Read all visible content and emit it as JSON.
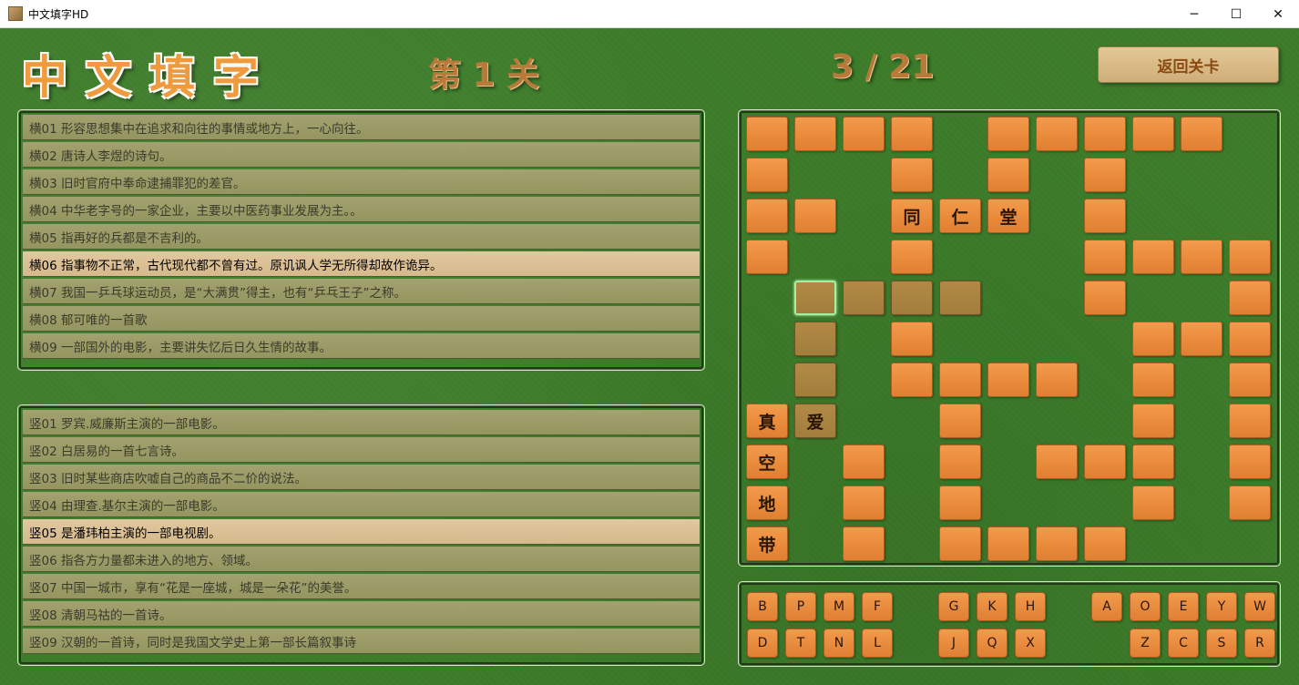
{
  "window": {
    "title": "中文填字HD",
    "minimize": "─",
    "maximize": "☐",
    "close": "✕"
  },
  "header": {
    "logo": "中文填字",
    "level": "第 1 关",
    "progress": "3 / 21",
    "back_button": "返回关卡"
  },
  "clues_across": [
    {
      "text": "横01 形容思想集中在追求和向往的事情或地方上，一心向往。",
      "active": false
    },
    {
      "text": "横02 唐诗人李煜的诗句。",
      "active": false
    },
    {
      "text": "横03 旧时官府中奉命逮捕罪犯的差官。",
      "active": false
    },
    {
      "text": "横04 中华老字号的一家企业，主要以中医药事业发展为主。。",
      "active": false
    },
    {
      "text": "横05 指再好的兵都是不吉利的。",
      "active": false
    },
    {
      "text": "横06 指事物不正常，古代现代都不曾有过。原讥讽人学无所得却故作诡异。",
      "active": true
    },
    {
      "text": "横07 我国一乒乓球运动员，是“大满贯”得主，也有“乒乓王子”之称。",
      "active": false
    },
    {
      "text": "横08 郁可唯的一首歌",
      "active": false
    },
    {
      "text": "横09 一部国外的电影，主要讲失忆后日久生情的故事。",
      "active": false
    }
  ],
  "clues_down": [
    {
      "text": "竖01 罗宾.威廉斯主演的一部电影。",
      "active": false
    },
    {
      "text": "竖02 白居易的一首七言诗。",
      "active": false
    },
    {
      "text": "竖03 旧时某些商店吹嘘自己的商品不二价的说法。",
      "active": false
    },
    {
      "text": "竖04 由理查.基尔主演的一部电影。",
      "active": false
    },
    {
      "text": "竖05 是潘玮柏主演的一部电视剧。",
      "active": true
    },
    {
      "text": "竖06 指各方力量都未进入的地方、领域。",
      "active": false
    },
    {
      "text": "竖07 中国一城市，享有“花是一座城，城是一朵花”的美誉。",
      "active": false
    },
    {
      "text": "竖08 清朝马祜的一首诗。",
      "active": false
    },
    {
      "text": "竖09 汉朝的一首诗，同时是我国文学史上第一部长篇叙事诗",
      "active": false
    }
  ],
  "grid": {
    "rows": [
      [
        1,
        1,
        1,
        1,
        0,
        1,
        1,
        1,
        1,
        1,
        0
      ],
      [
        1,
        0,
        0,
        1,
        0,
        1,
        0,
        1,
        0,
        0,
        0
      ],
      [
        1,
        1,
        0,
        1,
        1,
        1,
        0,
        1,
        0,
        0,
        0
      ],
      [
        1,
        0,
        0,
        1,
        0,
        0,
        0,
        1,
        1,
        1,
        1
      ],
      [
        0,
        2,
        2,
        2,
        2,
        0,
        0,
        1,
        0,
        0,
        1
      ],
      [
        0,
        2,
        0,
        1,
        0,
        0,
        0,
        0,
        1,
        1,
        1
      ],
      [
        0,
        2,
        0,
        1,
        1,
        1,
        1,
        0,
        1,
        0,
        1
      ],
      [
        1,
        2,
        0,
        0,
        1,
        0,
        0,
        0,
        1,
        0,
        1
      ],
      [
        1,
        0,
        1,
        0,
        1,
        0,
        1,
        1,
        1,
        0,
        1
      ],
      [
        1,
        0,
        1,
        0,
        1,
        0,
        0,
        0,
        1,
        0,
        1
      ],
      [
        1,
        0,
        1,
        0,
        1,
        1,
        1,
        1,
        0,
        0,
        0
      ]
    ],
    "selected": [
      4,
      1
    ],
    "letters": [
      {
        "r": 2,
        "c": 3,
        "ch": "同"
      },
      {
        "r": 2,
        "c": 4,
        "ch": "仁"
      },
      {
        "r": 2,
        "c": 5,
        "ch": "堂"
      },
      {
        "r": 7,
        "c": 0,
        "ch": "真"
      },
      {
        "r": 7,
        "c": 1,
        "ch": "爱"
      },
      {
        "r": 8,
        "c": 0,
        "ch": "空"
      },
      {
        "r": 9,
        "c": 0,
        "ch": "地"
      },
      {
        "r": 10,
        "c": 0,
        "ch": "带"
      }
    ]
  },
  "keyboard": {
    "row1": [
      {
        "label": "B",
        "col": 0
      },
      {
        "label": "P",
        "col": 1
      },
      {
        "label": "M",
        "col": 2
      },
      {
        "label": "F",
        "col": 3
      },
      {
        "label": "G",
        "col": 5
      },
      {
        "label": "K",
        "col": 6
      },
      {
        "label": "H",
        "col": 7
      },
      {
        "label": "A",
        "col": 9
      },
      {
        "label": "O",
        "col": 10
      },
      {
        "label": "E",
        "col": 11
      },
      {
        "label": "Y",
        "col": 12
      },
      {
        "label": "W",
        "col": 13
      }
    ],
    "row2": [
      {
        "label": "D",
        "col": 0
      },
      {
        "label": "T",
        "col": 1
      },
      {
        "label": "N",
        "col": 2
      },
      {
        "label": "L",
        "col": 3
      },
      {
        "label": "J",
        "col": 5
      },
      {
        "label": "Q",
        "col": 6
      },
      {
        "label": "X",
        "col": 7
      },
      {
        "label": "Z",
        "col": 10
      },
      {
        "label": "C",
        "col": 11
      },
      {
        "label": "S",
        "col": 12
      },
      {
        "label": "R",
        "col": 13
      }
    ]
  }
}
